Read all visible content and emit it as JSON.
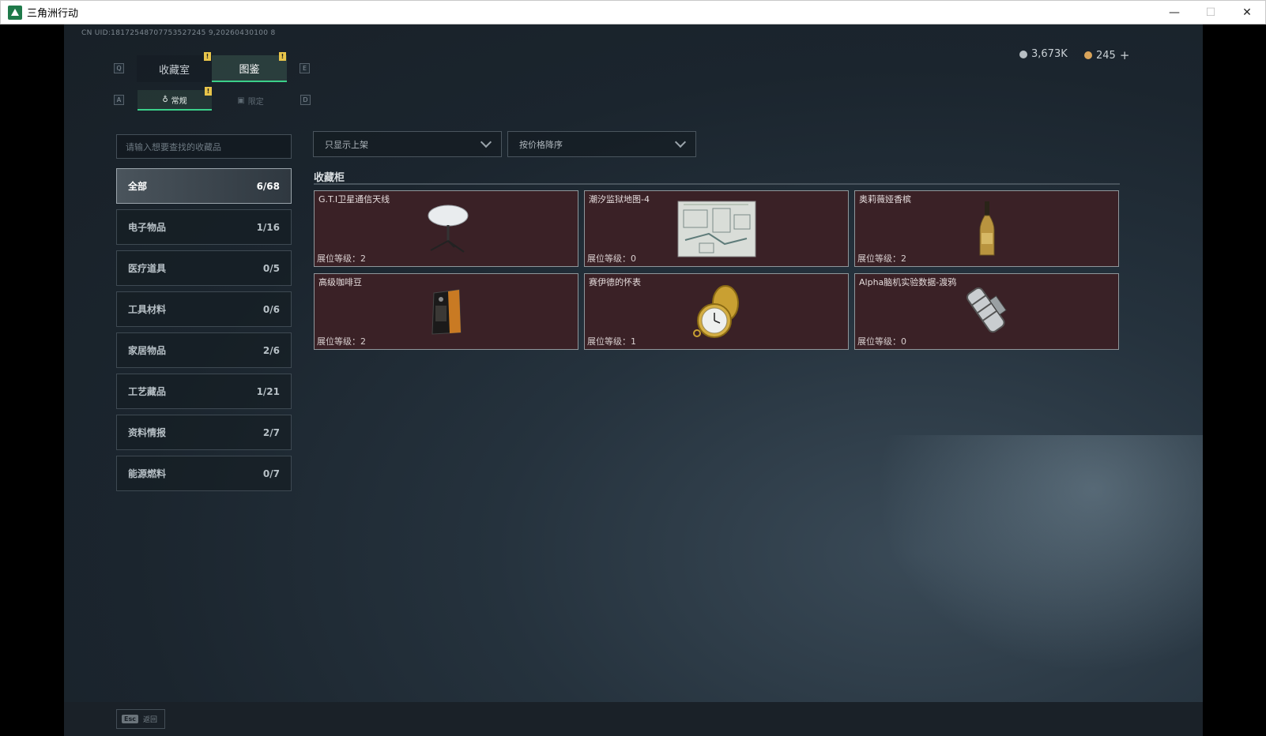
{
  "window": {
    "title": "三角洲行动",
    "controls": {
      "minimize": "—",
      "maximize": "☐",
      "close": "✕"
    }
  },
  "uid": "CN UID:18172548707753527245 9,20260430100 8",
  "tabs": {
    "prev_key": "Q",
    "next_key": "E",
    "items": [
      {
        "label": "收藏室",
        "active": false,
        "badge": "!"
      },
      {
        "label": "图鉴",
        "active": true,
        "badge": "!"
      }
    ]
  },
  "subtabs": {
    "prev_key": "A",
    "next_key": "D",
    "items": [
      {
        "label": "常规",
        "active": true,
        "badge": "!"
      },
      {
        "label": "限定",
        "active": false
      }
    ]
  },
  "currency": [
    {
      "value": "3,673K",
      "icon": "silver-coin-icon",
      "color": "#b8bfc4"
    },
    {
      "value": "245",
      "icon": "gold-coin-icon",
      "color": "#d9a45a",
      "add": "+"
    }
  ],
  "search": {
    "placeholder": "请输入想要查找的收藏品"
  },
  "filters": {
    "display": "只显示上架",
    "sort": "按价格降序"
  },
  "categories": [
    {
      "name": "全部",
      "count": "6/68",
      "active": true
    },
    {
      "name": "电子物品",
      "count": "1/16"
    },
    {
      "name": "医疗道具",
      "count": "0/5"
    },
    {
      "name": "工具材料",
      "count": "0/6"
    },
    {
      "name": "家居物品",
      "count": "2/6"
    },
    {
      "name": "工艺藏品",
      "count": "1/21"
    },
    {
      "name": "资料情报",
      "count": "2/7"
    },
    {
      "name": "能源燃料",
      "count": "0/7"
    }
  ],
  "cabinet": {
    "title": "收藏柜",
    "items": [
      {
        "name": "G.T.I卫星通信天线",
        "level": "展位等级：2",
        "icon": "satellite-dish-icon"
      },
      {
        "name": "潮汐监狱地图-4",
        "level": "展位等级：0",
        "icon": "map-icon"
      },
      {
        "name": "奥莉薇娅香槟",
        "level": "展位等级：2",
        "icon": "champagne-bottle-icon"
      },
      {
        "name": "高级咖啡豆",
        "level": "展位等级：2",
        "icon": "coffee-bag-icon"
      },
      {
        "name": "赛伊德的怀表",
        "level": "展位等级：1",
        "icon": "pocket-watch-icon"
      },
      {
        "name": "Alpha脑机实验数据-渡鸦",
        "level": "展位等级：0",
        "icon": "data-canister-icon"
      }
    ]
  },
  "footer": {
    "esc_key": "Esc",
    "back_label": "返回"
  }
}
